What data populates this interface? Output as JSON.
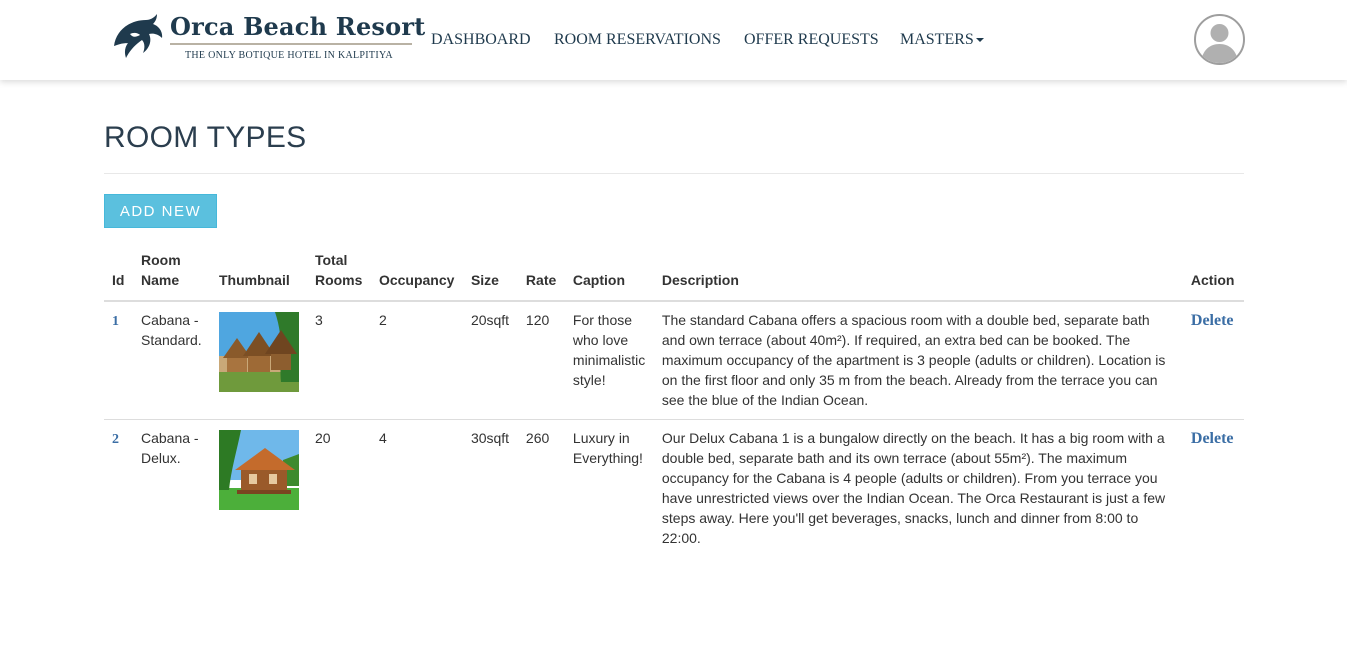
{
  "brand": {
    "name": "Orca Beach Resort",
    "tagline": "THE ONLY BOTIQUE HOTEL IN KALPITIYA",
    "primary_color": "#1f3a4d"
  },
  "nav": {
    "items": [
      "DASHBOARD",
      "ROOM RESERVATIONS",
      "OFFER REQUESTS",
      "MASTERS"
    ]
  },
  "page": {
    "title": "ROOM TYPES",
    "add_button": "ADD NEW",
    "accent_color": "#5bc0de"
  },
  "table": {
    "headers": {
      "id": "Id",
      "room_name": "Room Name",
      "thumbnail": "Thumbnail",
      "total_rooms": "Total Rooms",
      "occupancy": "Occupancy",
      "size": "Size",
      "rate": "Rate",
      "caption": "Caption",
      "description": "Description",
      "action": "Action"
    },
    "rows": [
      {
        "id": "1",
        "room_name": "Cabana - Standard.",
        "thumbnail": "cabana-standard-thumbnail",
        "total_rooms": "3",
        "occupancy": "2",
        "size": "20sqft",
        "rate": "120",
        "caption": "For those who love minimalistic style!",
        "description": "The standard Cabana offers a spacious room with a double bed, separate bath and own terrace (about 40m²). If required, an extra bed can be booked. The maximum occupancy of the apartment is 3 people (adults or children). Location is on the first floor and only 35 m from the beach. Already from the terrace you can see the blue of the Indian Ocean.",
        "action": "Delete"
      },
      {
        "id": "2",
        "room_name": "Cabana - Delux.",
        "thumbnail": "cabana-delux-thumbnail",
        "total_rooms": "20",
        "occupancy": "4",
        "size": "30sqft",
        "rate": "260",
        "caption": "Luxury in Everything!",
        "description": "Our Delux Cabana 1 is a bungalow directly on the beach. It has a big room with a double bed, separate bath and its own terrace (about 55m²). The maximum occupancy for the Cabana is 4 people (adults or children). From you terrace you have unrestricted views over the Indian Ocean. The Orca Restaurant is just a few steps away. Here you'll get beverages, snacks, lunch and dinner from 8:00 to 22:00.",
        "action": "Delete"
      }
    ]
  }
}
